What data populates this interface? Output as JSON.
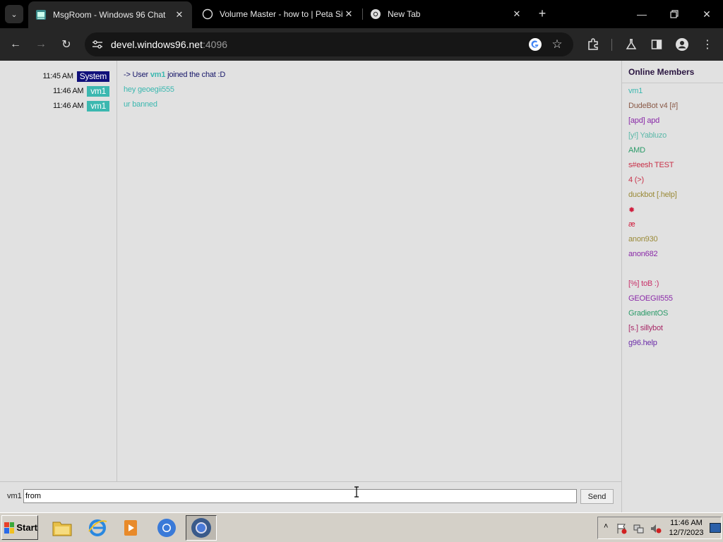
{
  "browser": {
    "tabs": [
      {
        "title": "MsgRoom - Windows 96 Chat",
        "active": true,
        "icon": "windows96-favicon"
      },
      {
        "title": "Volume Master - how to | Peta Sit",
        "active": false,
        "icon": "globe-icon"
      },
      {
        "title": "New Tab",
        "active": false,
        "icon": "chrome-icon"
      }
    ],
    "url_host": "devel.windows96.net",
    "url_port": ":4096"
  },
  "chat": {
    "rows": [
      {
        "time": "11:45 AM",
        "sender": "System",
        "type": "system",
        "text_prefix": "-> User ",
        "text_bold": "vm1",
        "text_suffix": " joined the chat :D"
      },
      {
        "time": "11:46 AM",
        "sender": "vm1",
        "type": "user",
        "text": "hey geoegii555"
      },
      {
        "time": "11:46 AM",
        "sender": "vm1",
        "type": "user",
        "text": "ur banned"
      }
    ]
  },
  "members": {
    "title": "Online Members",
    "list": [
      {
        "name": "vm1",
        "color": "#3cb8b0"
      },
      {
        "name": "DudeBot v4 [#]",
        "color": "#8a5a48"
      },
      {
        "name": "[apd] apd",
        "color": "#8a2aa8"
      },
      {
        "name": "[y!] Yabluzo",
        "color": "#5ab8a8"
      },
      {
        "name": "AMD",
        "color": "#2a9a68"
      },
      {
        "name": "s#eesh TEST",
        "color": "#c83048"
      },
      {
        "name": "4 (>)",
        "color": "#c83048"
      },
      {
        "name": "duckbot [.help]",
        "color": "#9a8a38"
      },
      {
        "name": "✹",
        "color": "#d02040"
      },
      {
        "name": "æ",
        "color": "#d02040"
      },
      {
        "name": "anon930",
        "color": "#9a8a38"
      },
      {
        "name": "anon682",
        "color": "#8a2aa8"
      },
      {
        "name": "",
        "color": "#000000"
      },
      {
        "name": "[%] toB :)",
        "color": "#c83068"
      },
      {
        "name": "GEOEGII555",
        "color": "#8a2aa8"
      },
      {
        "name": "GradientOS",
        "color": "#2a9a68"
      },
      {
        "name": "[s.] sillybot",
        "color": "#a82a68"
      },
      {
        "name": "g96.help",
        "color": "#6a2aa8"
      }
    ]
  },
  "composer": {
    "nick": "vm1",
    "value": "from ",
    "send_label": "Send"
  },
  "taskbar": {
    "start_label": "Start",
    "clock_time": "11:46 AM",
    "clock_date": "12/7/2023"
  }
}
